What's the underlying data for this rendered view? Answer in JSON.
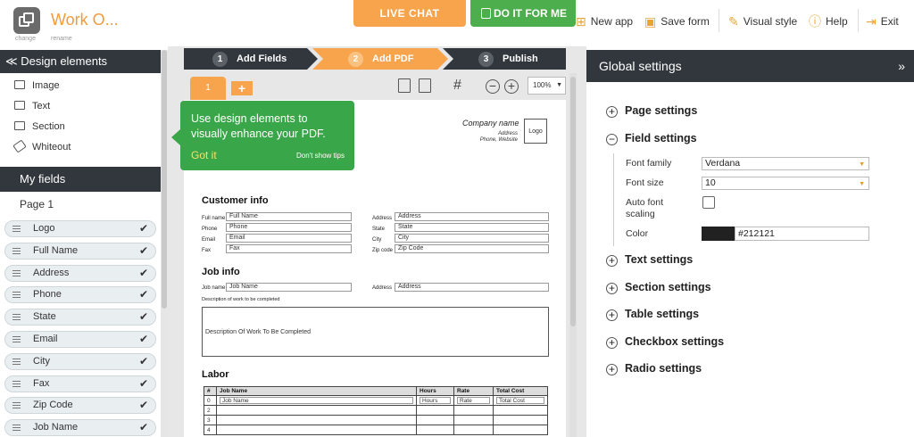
{
  "header": {
    "app_title": "Work O...",
    "logo_caption": "change",
    "title_caption": "rename",
    "live_chat": "LIVE CHAT",
    "do_it_for_me": "DO IT FOR ME",
    "menu": [
      "New app",
      "Save form",
      "Visual style",
      "Help",
      "Exit"
    ],
    "menu_icons": [
      "plus-square-icon",
      "save-icon",
      "brush-icon",
      "help-icon",
      "exit-icon"
    ]
  },
  "design_elements": {
    "title": "Design elements",
    "items": [
      "Image",
      "Text",
      "Section",
      "Whiteout"
    ]
  },
  "my_fields": {
    "title": "My fields",
    "page": "Page 1",
    "items": [
      "Logo",
      "Full Name",
      "Address",
      "Phone",
      "State",
      "Email",
      "City",
      "Fax",
      "Zip Code",
      "Job Name"
    ]
  },
  "steps": [
    {
      "num": "1",
      "label": "Add Fields"
    },
    {
      "num": "2",
      "label": "Add PDF"
    },
    {
      "num": "3",
      "label": "Publish"
    }
  ],
  "toolbar": {
    "page_tab": "1",
    "add_tab": "+",
    "zoom": "100%"
  },
  "tip": {
    "text": "Use design elements to visually enhance your PDF.",
    "got_it": "Got it",
    "dont_show": "Don't show tips"
  },
  "pdf": {
    "company": "Company name",
    "address": "Address",
    "phone_website": "Phone, Website",
    "logo": "Logo",
    "customer_info": {
      "title": "Customer info",
      "left": [
        {
          "label": "Full name",
          "value": "Full Name"
        },
        {
          "label": "Phone",
          "value": "Phone"
        },
        {
          "label": "Email",
          "value": "Email"
        },
        {
          "label": "Fax",
          "value": "Fax"
        }
      ],
      "right": [
        {
          "label": "Address",
          "value": "Address"
        },
        {
          "label": "State",
          "value": "State"
        },
        {
          "label": "City",
          "value": "City"
        },
        {
          "label": "Zip code",
          "value": "Zip Code"
        }
      ]
    },
    "job_info": {
      "title": "Job info",
      "job_label": "Job name",
      "job_value": "Job Name",
      "addr_label": "Address",
      "addr_value": "Address",
      "desc_caption": "Description of work to be completed",
      "desc_value": "Description Of Work To Be Completed"
    },
    "labor": {
      "title": "Labor",
      "headers": [
        "#",
        "Job Name",
        "Hours",
        "Rate",
        "Total Cost"
      ],
      "row1": [
        "0",
        "Job Name",
        "Hours",
        "Rate",
        "Total Cost"
      ],
      "row_nums": [
        "2",
        "3",
        "4"
      ]
    }
  },
  "global_settings": {
    "title": "Global settings",
    "collapse_icon": "»",
    "sections_before": [
      "Page settings"
    ],
    "open_section": "Field settings",
    "sections_after": [
      "Text settings",
      "Section settings",
      "Table settings",
      "Checkbox settings",
      "Radio settings"
    ],
    "field_settings": {
      "font_family_label": "Font family",
      "font_family": "Verdana",
      "font_size_label": "Font size",
      "font_size": "10",
      "auto_font_label": "Auto font scaling",
      "color_label": "Color",
      "color": "#212121"
    }
  }
}
